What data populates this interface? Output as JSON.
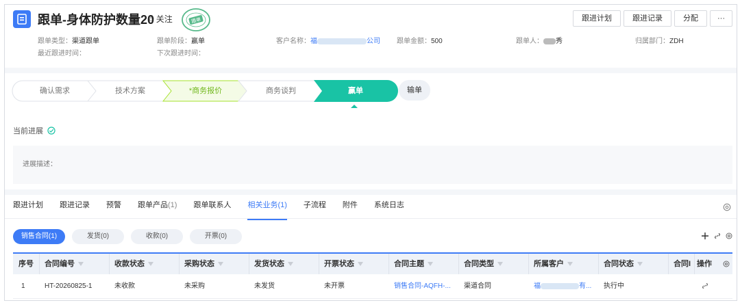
{
  "header": {
    "title": "跟单-身体防护数量20",
    "follow_label": "关注",
    "stamp_text": "跟单",
    "buttons": [
      "跟进计划",
      "跟进记录",
      "分配",
      "···"
    ]
  },
  "meta": {
    "type_label": "跟单类型：",
    "type_value": "渠道跟单",
    "stage_label": "跟单阶段：",
    "stage_value": "赢单",
    "customer_label": "客户名称：",
    "customer_prefix": "福",
    "customer_suffix": "公司",
    "amount_label": "跟单金额：",
    "amount_value": "500",
    "owner_label": "跟单人：",
    "owner_suffix": "秀",
    "dept_label": "归属部门：",
    "dept_value": "ZDH",
    "last_follow_label": "最近跟进时间：",
    "next_follow_label": "下次跟进时间："
  },
  "stages": {
    "items": [
      "确认需求",
      "技术方案",
      "*商务报价",
      "商务谈判",
      "赢单"
    ],
    "lose_label": "输单",
    "current": "赢单"
  },
  "progress": {
    "label": "当前进展",
    "desc_label": "进展描述："
  },
  "tabs": [
    {
      "label": "跟进计划",
      "count": ""
    },
    {
      "label": "跟进记录",
      "count": ""
    },
    {
      "label": "预警",
      "count": ""
    },
    {
      "label": "跟单产品",
      "count": "(1)"
    },
    {
      "label": "跟单联系人",
      "count": ""
    },
    {
      "label": "相关业务",
      "count": "(1)"
    },
    {
      "label": "子流程",
      "count": ""
    },
    {
      "label": "附件",
      "count": ""
    },
    {
      "label": "系统日志",
      "count": ""
    }
  ],
  "active_tab": "相关业务",
  "subtabs": [
    "销售合同(1)",
    "发货(0)",
    "收款(0)",
    "开票(0)"
  ],
  "table": {
    "headers": [
      "序号",
      "合同编号",
      "收款状态",
      "采购状态",
      "发货状态",
      "开票状态",
      "合同主题",
      "合同类型",
      "所属客户",
      "合同状态",
      "合同I",
      "操作"
    ],
    "row": {
      "index": "1",
      "contract_no": "HT-20260825-1",
      "payment_status": "未收款",
      "purchase_status": "未采购",
      "delivery_status": "未发货",
      "invoice_status": "未开票",
      "subject": "销售合同-AQFH-...",
      "contract_type": "渠道合同",
      "customer_prefix": "福",
      "customer_suffix": "有...",
      "contract_status": "执行中"
    }
  },
  "colors": {
    "accent": "#3d7bf6",
    "stage_done": "#19c3a5",
    "stage_current_border": "#a6e22e"
  }
}
